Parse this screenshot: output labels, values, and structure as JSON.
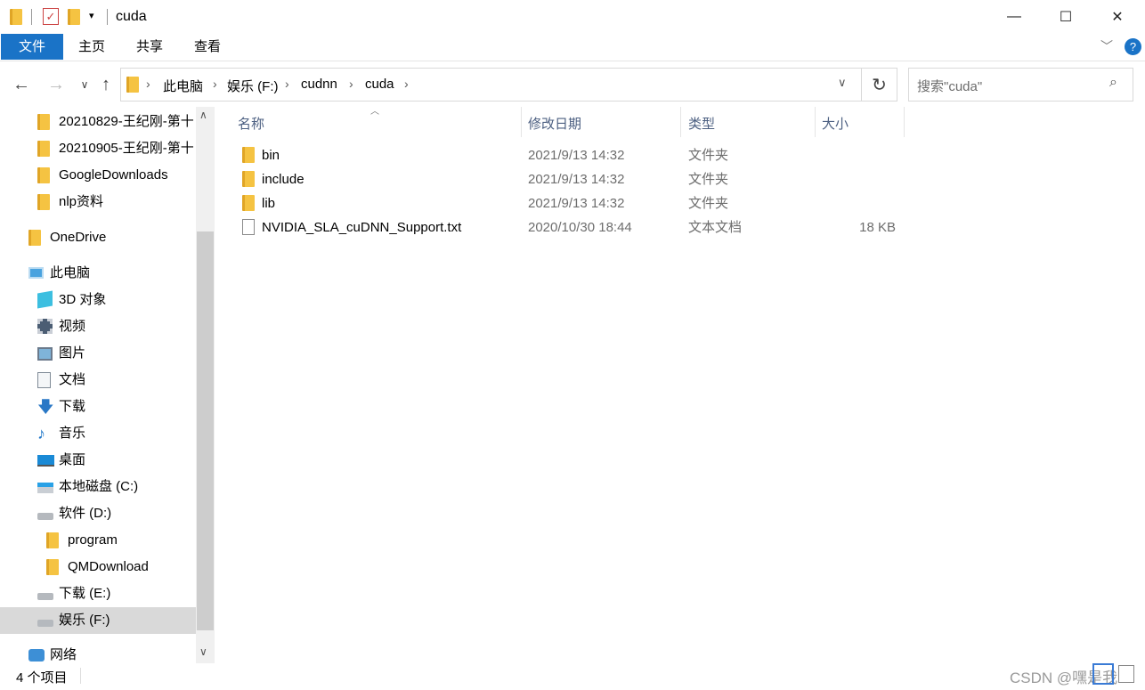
{
  "window": {
    "title": "cuda",
    "minimize": "—",
    "maximize": "☐",
    "close": "✕"
  },
  "ribbon": {
    "tabs": [
      "文件",
      "主页",
      "共享",
      "查看"
    ],
    "expand": "﹀",
    "help": "?"
  },
  "address": {
    "crumbs": [
      "此电脑",
      "娱乐 (F:)",
      "cudnn",
      "cuda"
    ],
    "search_placeholder": "搜索\"cuda\""
  },
  "sidebar": {
    "items": [
      {
        "label": "20210829-王纪刚-第十",
        "icon": "folder-icon"
      },
      {
        "label": "20210905-王纪刚-第十",
        "icon": "folder-icon"
      },
      {
        "label": "GoogleDownloads",
        "icon": "folder-icon"
      },
      {
        "label": "nlp资料",
        "icon": "folder-icon"
      },
      {
        "label": "OneDrive",
        "icon": "folder-icon"
      },
      {
        "label": "此电脑",
        "icon": "pc-icon"
      },
      {
        "label": "3D 对象",
        "icon": "cube-icon"
      },
      {
        "label": "视频",
        "icon": "video-icon"
      },
      {
        "label": "图片",
        "icon": "picture-icon"
      },
      {
        "label": "文档",
        "icon": "document-icon"
      },
      {
        "label": "下载",
        "icon": "download-arrow-icon"
      },
      {
        "label": "音乐",
        "icon": "music-note-icon"
      },
      {
        "label": "桌面",
        "icon": "desktop-icon"
      },
      {
        "label": "本地磁盘 (C:)",
        "icon": "windows-drive-icon"
      },
      {
        "label": "软件 (D:)",
        "icon": "drive-icon"
      },
      {
        "label": "program",
        "icon": "folder-icon"
      },
      {
        "label": "QMDownload",
        "icon": "folder-icon"
      },
      {
        "label": "下载 (E:)",
        "icon": "drive-icon"
      },
      {
        "label": "娱乐 (F:)",
        "icon": "drive-icon"
      },
      {
        "label": "网络",
        "icon": "network-icon"
      }
    ]
  },
  "columns": {
    "name": "名称",
    "modified": "修改日期",
    "type": "类型",
    "size": "大小"
  },
  "files": [
    {
      "name": "bin",
      "modified": "2021/9/13 14:32",
      "type": "文件夹",
      "size": "",
      "icon": "folder-icon"
    },
    {
      "name": "include",
      "modified": "2021/9/13 14:32",
      "type": "文件夹",
      "size": "",
      "icon": "folder-icon"
    },
    {
      "name": "lib",
      "modified": "2021/9/13 14:32",
      "type": "文件夹",
      "size": "",
      "icon": "folder-icon"
    },
    {
      "name": "NVIDIA_SLA_cuDNN_Support.txt",
      "modified": "2020/10/30 18:44",
      "type": "文本文档",
      "size": "18 KB",
      "icon": "text-file-icon"
    }
  ],
  "status": {
    "count": "4 个项目"
  },
  "watermark": "CSDN @嘿是我"
}
